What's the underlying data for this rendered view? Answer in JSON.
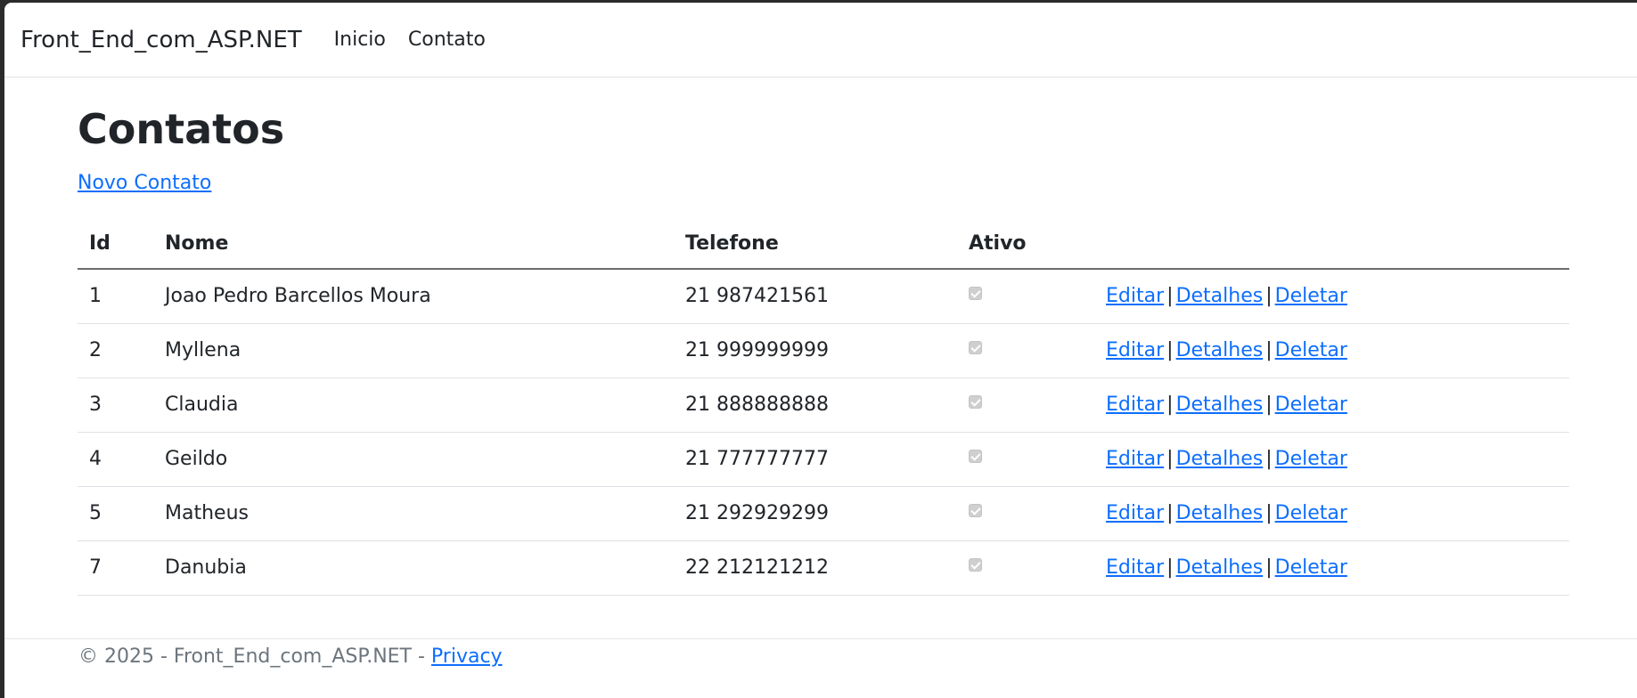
{
  "navbar": {
    "brand": "Front_End_com_ASP.NET",
    "links": [
      "Inicio",
      "Contato"
    ]
  },
  "page": {
    "title": "Contatos",
    "new_link": "Novo Contato"
  },
  "table": {
    "headers": [
      "Id",
      "Nome",
      "Telefone",
      "Ativo"
    ],
    "rows": [
      {
        "id": "1",
        "nome": "Joao Pedro Barcellos Moura",
        "telefone": "21 987421561",
        "ativo": true
      },
      {
        "id": "2",
        "nome": "Myllena",
        "telefone": "21 999999999",
        "ativo": true
      },
      {
        "id": "3",
        "nome": "Claudia",
        "telefone": "21 888888888",
        "ativo": true
      },
      {
        "id": "4",
        "nome": "Geildo",
        "telefone": "21 777777777",
        "ativo": true
      },
      {
        "id": "5",
        "nome": "Matheus",
        "telefone": "21 292929299",
        "ativo": true
      },
      {
        "id": "7",
        "nome": "Danubia",
        "telefone": "22 212121212",
        "ativo": true
      }
    ],
    "actions": {
      "edit": "Editar",
      "details": "Detalhes",
      "delete": "Deletar",
      "separator": "|"
    }
  },
  "footer": {
    "text": "© 2025 - Front_End_com_ASP.NET - ",
    "privacy": "Privacy"
  },
  "colors": {
    "link": "#0d6efd",
    "text": "#212529",
    "muted": "#6c757d"
  }
}
